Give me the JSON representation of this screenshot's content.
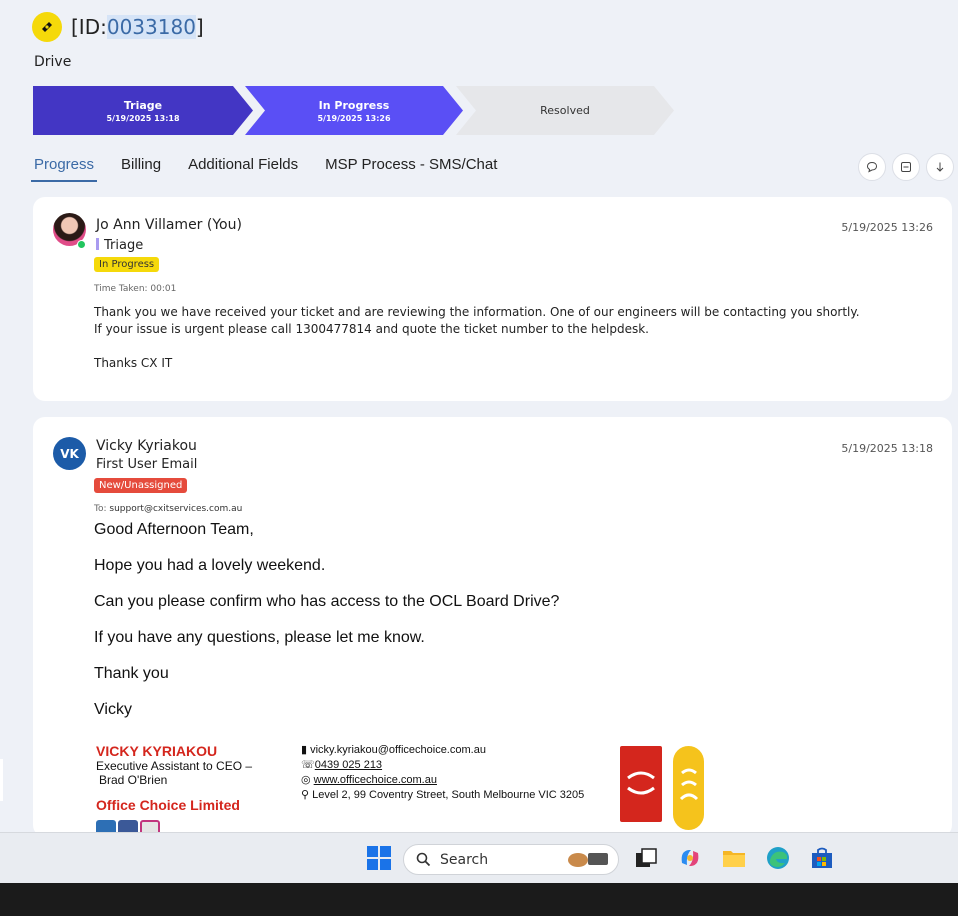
{
  "ticket": {
    "id_prefix": "[ID:",
    "id_number": "0033180",
    "id_suffix": "]",
    "title": "Drive"
  },
  "stepper": [
    {
      "label": "Triage",
      "date": "5/19/2025 13:18"
    },
    {
      "label": "In Progress",
      "date": "5/19/2025 13:26"
    },
    {
      "label": "Resolved",
      "date": ""
    }
  ],
  "tabs": [
    {
      "label": "Progress"
    },
    {
      "label": "Billing"
    },
    {
      "label": "Additional Fields"
    },
    {
      "label": "MSP Process - SMS/Chat"
    }
  ],
  "entries": [
    {
      "author": "Jo Ann Villamer (You)",
      "stage": "Triage",
      "status": "In Progress",
      "timestamp": "5/19/2025 13:26",
      "time_taken": "Time Taken: 00:01",
      "message_line1": "Thank you we have received your ticket and are reviewing the information. One of our engineers will be contacting you shortly.",
      "message_line2": "If your issue is urgent please call 1300477814 and quote the ticket number to the helpdesk.",
      "message_line3": "Thanks CX IT"
    },
    {
      "initials": "VK",
      "author": "Vicky Kyriakou",
      "subtitle": "First User Email",
      "status": "New/Unassigned",
      "timestamp": "5/19/2025 13:18",
      "to_label": "To:",
      "to_email": "support@cxitservices.com.au",
      "body": [
        "Good Afternoon Team,",
        "Hope you had a lovely weekend.",
        "Can you please confirm who has access to the OCL Board Drive?",
        "If you have any questions, please let me know.",
        "Thank you",
        "Vicky"
      ],
      "signature": {
        "name": "VICKY KYRIAKOU",
        "role_line1": "Executive Assistant to CEO –",
        "role_line2": "Brad O'Brien",
        "company": "Office Choice Limited",
        "email": "vicky.kyriakou@officechoice.com.au",
        "phone": "0439 025 213",
        "website": "www.officechoice.com.au",
        "address": "Level 2, 99 Coventry Street, South Melbourne VIC 3205"
      }
    }
  ],
  "taskbar": {
    "search_label": "Search"
  },
  "colors": {
    "accent": "#3b6aa6",
    "step_done": "#4336c4",
    "step_current": "#5a4ff5",
    "badge_yellow": "#f5d90a",
    "badge_red": "#e54b3c"
  }
}
